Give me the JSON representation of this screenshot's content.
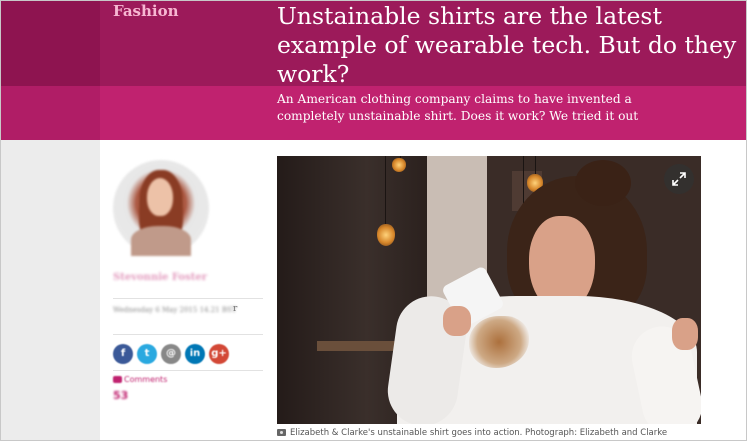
{
  "header": {
    "section": "Fashion",
    "headline": "Unstainable shirts are the latest example of wearable tech. But do they work?",
    "standfirst": "An American clothing company claims to have invented a completely unstainable shirt. Does it work? We tried it out"
  },
  "byline": {
    "author": "Stevonnie Foster",
    "dateline": "Wednesday 6 May 2015 14.21 BST",
    "dateline_trail": "r",
    "share_buttons": [
      {
        "icon": "facebook-icon",
        "glyph": "f",
        "color": "#3b5998"
      },
      {
        "icon": "twitter-icon",
        "glyph": "t",
        "color": "#2aa9e0"
      },
      {
        "icon": "email-icon",
        "glyph": "@",
        "color": "#888888"
      },
      {
        "icon": "linkedin-icon",
        "glyph": "in",
        "color": "#0077b5"
      },
      {
        "icon": "googleplus-icon",
        "glyph": "g+",
        "color": "#d34836"
      }
    ],
    "comments_label": "Comments",
    "comments_count": "53"
  },
  "media": {
    "caption": "Elizabeth & Clarke's unstainable shirt goes into action. Photograph: Elizabeth and Clarke"
  },
  "colors": {
    "header_dark": "#9c1a5a",
    "header_light": "#c0226f",
    "section_label": "#f7b7d2"
  }
}
